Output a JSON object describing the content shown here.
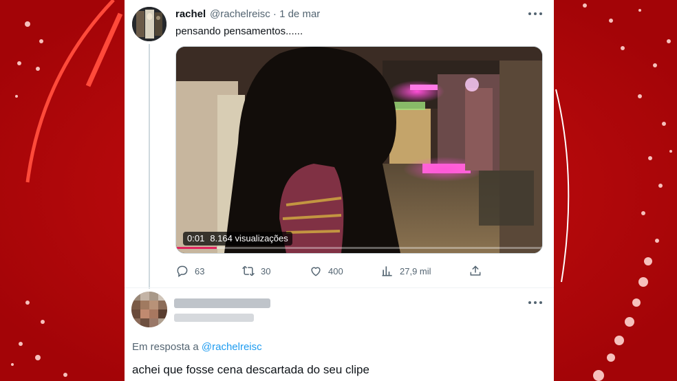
{
  "tweet": {
    "author_name": "rachel",
    "handle_line": "@rachelreisc · 1 de mar",
    "text": "pensando pensamentos......",
    "video": {
      "time": "0:01",
      "views": "8.164 visualizações",
      "progress": 0.11
    },
    "actions": {
      "replies": "63",
      "retweets": "30",
      "likes": "400",
      "views": "27,9 mil"
    }
  },
  "reply": {
    "in_reply_prefix": "Em resposta a ",
    "in_reply_mention": "@rachelreisc",
    "text": "achei que fosse cena descartada do seu clipe"
  },
  "icons": [
    "more-icon",
    "reply-icon",
    "retweet-icon",
    "like-icon",
    "views-icon",
    "share-icon"
  ],
  "colors": {
    "background": "#b5080b",
    "card": "#ffffff",
    "muted": "#536471",
    "link": "#1d9bf0",
    "video_progress": "#e0245e"
  }
}
